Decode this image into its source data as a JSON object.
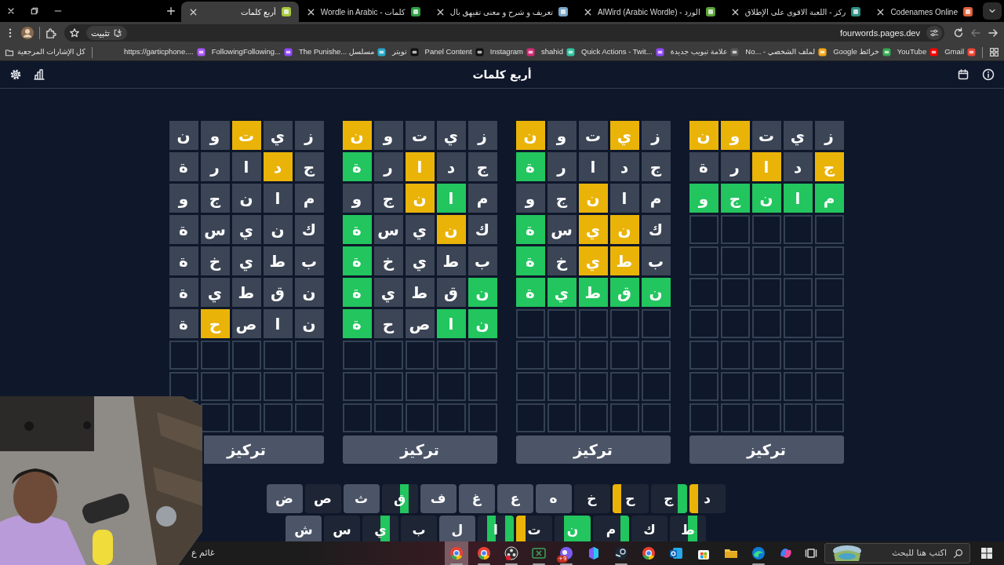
{
  "browser": {
    "tabs": [
      {
        "title": "Codenames Online",
        "selected": false
      },
      {
        "title": "ركز - اللعبة الاقوى على الإطلاق",
        "selected": false
      },
      {
        "title": "AlWird (Arabic Wordle) - الورد",
        "selected": false
      },
      {
        "title": "تعريف و شرح و معنى تفيهق بال",
        "selected": false
      },
      {
        "title": "Wordle in Arabic - كلمات",
        "selected": false
      },
      {
        "title": "أربع كلمات",
        "selected": true
      }
    ],
    "url": "fourwords.pages.dev",
    "install_button": "تثبيت",
    "bookmarks": [
      {
        "label": "Gmail"
      },
      {
        "label": "YouTube"
      },
      {
        "label": "خرائط Google"
      },
      {
        "label": "No... - لملف الشخصي"
      },
      {
        "label": "علامة تبويب جديدة"
      },
      {
        "label": "Quick Actions - Twit..."
      },
      {
        "label": "shahid"
      },
      {
        "label": "Instagram"
      },
      {
        "label": "Panel Content"
      },
      {
        "label": "تويتر"
      },
      {
        "label": "The Punishe... مسلسل"
      },
      {
        "label": "FollowingFollowing..."
      },
      {
        "label": "https://garticphone...."
      }
    ],
    "all_bookmarks": "كل الإشارات المرجعية"
  },
  "game": {
    "title": "أربع كلمات",
    "boards": [
      {
        "button": "تركيز",
        "rows": [
          {
            "tiles": [
              {
                "letter": "ز",
                "color": "#3b4556"
              },
              {
                "letter": "ي",
                "color": "#3b4556"
              },
              {
                "letter": "ت",
                "color": "#3b4556"
              },
              {
                "letter": "و",
                "color": "#eab308"
              },
              {
                "letter": "ن",
                "color": "#eab308"
              }
            ]
          },
          {
            "tiles": [
              {
                "letter": "ج",
                "color": "#eab308"
              },
              {
                "letter": "د",
                "color": "#3b4556"
              },
              {
                "letter": "ا",
                "color": "#eab308"
              },
              {
                "letter": "ر",
                "color": "#3b4556"
              },
              {
                "letter": "ة",
                "color": "#3b4556"
              }
            ]
          },
          {
            "tiles": [
              {
                "letter": "م",
                "color": "#22c55e"
              },
              {
                "letter": "ا",
                "color": "#22c55e"
              },
              {
                "letter": "ن",
                "color": "#22c55e"
              },
              {
                "letter": "ج",
                "color": "#22c55e"
              },
              {
                "letter": "و",
                "color": "#22c55e"
              }
            ]
          }
        ]
      },
      {
        "button": "تركيز",
        "rows": [
          {
            "tiles": [
              {
                "letter": "ز",
                "color": "#3b4556"
              },
              {
                "letter": "ي",
                "color": "#eab308"
              },
              {
                "letter": "ت",
                "color": "#3b4556"
              },
              {
                "letter": "و",
                "color": "#3b4556"
              },
              {
                "letter": "ن",
                "color": "#eab308"
              }
            ]
          },
          {
            "tiles": [
              {
                "letter": "ج",
                "color": "#3b4556"
              },
              {
                "letter": "د",
                "color": "#3b4556"
              },
              {
                "letter": "ا",
                "color": "#3b4556"
              },
              {
                "letter": "ر",
                "color": "#3b4556"
              },
              {
                "letter": "ة",
                "color": "#22c55e"
              }
            ]
          },
          {
            "tiles": [
              {
                "letter": "م",
                "color": "#3b4556"
              },
              {
                "letter": "ا",
                "color": "#3b4556"
              },
              {
                "letter": "ن",
                "color": "#eab308"
              },
              {
                "letter": "ج",
                "color": "#3b4556"
              },
              {
                "letter": "و",
                "color": "#3b4556"
              }
            ]
          },
          {
            "tiles": [
              {
                "letter": "ك",
                "color": "#3b4556"
              },
              {
                "letter": "ن",
                "color": "#eab308"
              },
              {
                "letter": "ي",
                "color": "#eab308"
              },
              {
                "letter": "س",
                "color": "#3b4556"
              },
              {
                "letter": "ة",
                "color": "#22c55e"
              }
            ]
          },
          {
            "tiles": [
              {
                "letter": "ب",
                "color": "#3b4556"
              },
              {
                "letter": "ط",
                "color": "#eab308"
              },
              {
                "letter": "ي",
                "color": "#eab308"
              },
              {
                "letter": "خ",
                "color": "#3b4556"
              },
              {
                "letter": "ة",
                "color": "#22c55e"
              }
            ]
          },
          {
            "tiles": [
              {
                "letter": "ن",
                "color": "#22c55e"
              },
              {
                "letter": "ق",
                "color": "#22c55e"
              },
              {
                "letter": "ط",
                "color": "#22c55e"
              },
              {
                "letter": "ي",
                "color": "#22c55e"
              },
              {
                "letter": "ة",
                "color": "#22c55e"
              }
            ]
          }
        ]
      },
      {
        "button": "تركيز",
        "rows": [
          {
            "tiles": [
              {
                "letter": "ز",
                "color": "#3b4556"
              },
              {
                "letter": "ي",
                "color": "#3b4556"
              },
              {
                "letter": "ت",
                "color": "#3b4556"
              },
              {
                "letter": "و",
                "color": "#3b4556"
              },
              {
                "letter": "ن",
                "color": "#eab308"
              }
            ]
          },
          {
            "tiles": [
              {
                "letter": "ج",
                "color": "#3b4556"
              },
              {
                "letter": "د",
                "color": "#3b4556"
              },
              {
                "letter": "ا",
                "color": "#eab308"
              },
              {
                "letter": "ر",
                "color": "#3b4556"
              },
              {
                "letter": "ة",
                "color": "#22c55e"
              }
            ]
          },
          {
            "tiles": [
              {
                "letter": "م",
                "color": "#3b4556"
              },
              {
                "letter": "ا",
                "color": "#22c55e"
              },
              {
                "letter": "ن",
                "color": "#eab308"
              },
              {
                "letter": "ج",
                "color": "#3b4556"
              },
              {
                "letter": "و",
                "color": "#3b4556"
              }
            ]
          },
          {
            "tiles": [
              {
                "letter": "ك",
                "color": "#3b4556"
              },
              {
                "letter": "ن",
                "color": "#eab308"
              },
              {
                "letter": "ي",
                "color": "#3b4556"
              },
              {
                "letter": "س",
                "color": "#3b4556"
              },
              {
                "letter": "ة",
                "color": "#22c55e"
              }
            ]
          },
          {
            "tiles": [
              {
                "letter": "ب",
                "color": "#3b4556"
              },
              {
                "letter": "ط",
                "color": "#3b4556"
              },
              {
                "letter": "ي",
                "color": "#3b4556"
              },
              {
                "letter": "خ",
                "color": "#3b4556"
              },
              {
                "letter": "ة",
                "color": "#22c55e"
              }
            ]
          },
          {
            "tiles": [
              {
                "letter": "ن",
                "color": "#22c55e"
              },
              {
                "letter": "ق",
                "color": "#3b4556"
              },
              {
                "letter": "ط",
                "color": "#3b4556"
              },
              {
                "letter": "ي",
                "color": "#3b4556"
              },
              {
                "letter": "ة",
                "color": "#22c55e"
              }
            ]
          },
          {
            "tiles": [
              {
                "letter": "ن",
                "color": "#22c55e"
              },
              {
                "letter": "ا",
                "color": "#22c55e"
              },
              {
                "letter": "ص",
                "color": "#3b4556"
              },
              {
                "letter": "ح",
                "color": "#3b4556"
              },
              {
                "letter": "ة",
                "color": "#22c55e"
              }
            ]
          }
        ]
      },
      {
        "button": "تركيز",
        "rows": [
          {
            "tiles": [
              {
                "letter": "ز",
                "color": "#3b4556"
              },
              {
                "letter": "ي",
                "color": "#3b4556"
              },
              {
                "letter": "ت",
                "color": "#eab308"
              },
              {
                "letter": "و",
                "color": "#3b4556"
              },
              {
                "letter": "ن",
                "color": "#3b4556"
              }
            ]
          },
          {
            "tiles": [
              {
                "letter": "ج",
                "color": "#3b4556"
              },
              {
                "letter": "د",
                "color": "#eab308"
              },
              {
                "letter": "ا",
                "color": "#3b4556"
              },
              {
                "letter": "ر",
                "color": "#3b4556"
              },
              {
                "letter": "ة",
                "color": "#3b4556"
              }
            ]
          },
          {
            "tiles": [
              {
                "letter": "م",
                "color": "#3b4556"
              },
              {
                "letter": "ا",
                "color": "#3b4556"
              },
              {
                "letter": "ن",
                "color": "#3b4556"
              },
              {
                "letter": "ج",
                "color": "#3b4556"
              },
              {
                "letter": "و",
                "color": "#3b4556"
              }
            ]
          },
          {
            "tiles": [
              {
                "letter": "ك",
                "color": "#3b4556"
              },
              {
                "letter": "ن",
                "color": "#3b4556"
              },
              {
                "letter": "ي",
                "color": "#3b4556"
              },
              {
                "letter": "س",
                "color": "#3b4556"
              },
              {
                "letter": "ة",
                "color": "#3b4556"
              }
            ]
          },
          {
            "tiles": [
              {
                "letter": "ب",
                "color": "#3b4556"
              },
              {
                "letter": "ط",
                "color": "#3b4556"
              },
              {
                "letter": "ي",
                "color": "#3b4556"
              },
              {
                "letter": "خ",
                "color": "#3b4556"
              },
              {
                "letter": "ة",
                "color": "#3b4556"
              }
            ]
          },
          {
            "tiles": [
              {
                "letter": "ن",
                "color": "#3b4556"
              },
              {
                "letter": "ق",
                "color": "#3b4556"
              },
              {
                "letter": "ط",
                "color": "#3b4556"
              },
              {
                "letter": "ي",
                "color": "#3b4556"
              },
              {
                "letter": "ة",
                "color": "#3b4556"
              }
            ]
          },
          {
            "tiles": [
              {
                "letter": "ن",
                "color": "#3b4556"
              },
              {
                "letter": "ا",
                "color": "#3b4556"
              },
              {
                "letter": "ص",
                "color": "#3b4556"
              },
              {
                "letter": "ح",
                "color": "#eab308"
              },
              {
                "letter": "ة",
                "color": "#3b4556"
              }
            ]
          }
        ]
      }
    ],
    "keyboard": [
      {
        "keys": [
          {
            "key": "د",
            "color": "#1e2636",
            "strips": [
              {
                "marked": false
              },
              {
                "marked": false
              },
              {
                "marked": false
              },
              {
                "marked": true,
                "color": "#eab308"
              }
            ]
          },
          {
            "key": "ج",
            "color": "#1e2636",
            "strips": [
              {
                "marked": true,
                "color": "#22c55e"
              },
              {
                "marked": false
              },
              {
                "marked": false
              },
              {
                "marked": false
              }
            ]
          },
          {
            "key": "ح",
            "color": "#1e2636",
            "strips": [
              {
                "marked": false
              },
              {
                "marked": false
              },
              {
                "marked": false
              },
              {
                "marked": true,
                "color": "#eab308"
              }
            ]
          },
          {
            "key": "خ",
            "color": "#1e2636",
            "strips": [
              {
                "marked": false
              },
              {
                "marked": false
              },
              {
                "marked": false
              },
              {
                "marked": false
              }
            ]
          },
          {
            "key": "ه",
            "color": "#4b5567",
            "strips": [
              {
                "marked": false
              },
              {
                "marked": false
              },
              {
                "marked": false
              },
              {
                "marked": false
              }
            ]
          },
          {
            "key": "ع",
            "color": "#4b5567",
            "strips": [
              {
                "marked": false
              },
              {
                "marked": false
              },
              {
                "marked": false
              },
              {
                "marked": false
              }
            ]
          },
          {
            "key": "غ",
            "color": "#4b5567",
            "strips": [
              {
                "marked": false
              },
              {
                "marked": false
              },
              {
                "marked": false
              },
              {
                "marked": false
              }
            ]
          },
          {
            "key": "ف",
            "color": "#4b5567",
            "strips": [
              {
                "marked": false
              },
              {
                "marked": false
              },
              {
                "marked": false
              },
              {
                "marked": false
              }
            ]
          },
          {
            "key": "ق",
            "color": "#1e2636",
            "strips": [
              {
                "marked": false
              },
              {
                "marked": true,
                "color": "#22c55e"
              },
              {
                "marked": false
              },
              {
                "marked": false
              }
            ]
          },
          {
            "key": "ث",
            "color": "#4b5567",
            "strips": [
              {
                "marked": false
              },
              {
                "marked": false
              },
              {
                "marked": false
              },
              {
                "marked": false
              }
            ]
          },
          {
            "key": "ص",
            "color": "#1e2636",
            "strips": [
              {
                "marked": false
              },
              {
                "marked": false
              },
              {
                "marked": false
              },
              {
                "marked": false
              }
            ]
          },
          {
            "key": "ض",
            "color": "#4b5567",
            "strips": [
              {
                "marked": false
              },
              {
                "marked": false
              },
              {
                "marked": false
              },
              {
                "marked": false
              }
            ]
          }
        ]
      },
      {
        "keys": [
          {
            "key": "ط",
            "color": "#1e2636",
            "strips": [
              {
                "marked": false
              },
              {
                "marked": true,
                "color": "#22c55e"
              },
              {
                "marked": false
              },
              {
                "marked": false
              }
            ]
          },
          {
            "key": "ك",
            "color": "#1e2636",
            "strips": [
              {
                "marked": false
              },
              {
                "marked": false
              },
              {
                "marked": false
              },
              {
                "marked": false
              }
            ]
          },
          {
            "key": "م",
            "color": "#1e2636",
            "strips": [
              {
                "marked": true,
                "color": "#22c55e"
              },
              {
                "marked": false
              },
              {
                "marked": false
              },
              {
                "marked": false
              }
            ]
          },
          {
            "key": "ن",
            "color": "#1e2636",
            "strips": [
              {
                "marked": true,
                "color": "#22c55e"
              },
              {
                "marked": true,
                "color": "#22c55e"
              },
              {
                "marked": true,
                "color": "#22c55e"
              },
              {
                "marked": false
              }
            ]
          },
          {
            "key": "ت",
            "color": "#1e2636",
            "strips": [
              {
                "marked": false
              },
              {
                "marked": false
              },
              {
                "marked": false
              },
              {
                "marked": true,
                "color": "#eab308"
              }
            ]
          },
          {
            "key": "ا",
            "color": "#1e2636",
            "strips": [
              {
                "marked": true,
                "color": "#22c55e"
              },
              {
                "marked": false
              },
              {
                "marked": true,
                "color": "#22c55e"
              },
              {
                "marked": false
              }
            ]
          },
          {
            "key": "ل",
            "color": "#4b5567",
            "strips": [
              {
                "marked": false
              },
              {
                "marked": false
              },
              {
                "marked": false
              },
              {
                "marked": false
              }
            ]
          },
          {
            "key": "ب",
            "color": "#1e2636",
            "strips": [
              {
                "marked": false
              },
              {
                "marked": false
              },
              {
                "marked": false
              },
              {
                "marked": false
              }
            ]
          },
          {
            "key": "ي",
            "color": "#1e2636",
            "strips": [
              {
                "marked": false
              },
              {
                "marked": true,
                "color": "#22c55e"
              },
              {
                "marked": false
              },
              {
                "marked": false
              }
            ]
          },
          {
            "key": "س",
            "color": "#1e2636",
            "strips": [
              {
                "marked": false
              },
              {
                "marked": false
              },
              {
                "marked": false
              },
              {
                "marked": false
              }
            ]
          },
          {
            "key": "ش",
            "color": "#4b5567",
            "strips": [
              {
                "marked": false
              },
              {
                "marked": false
              },
              {
                "marked": false
              },
              {
                "marked": false
              }
            ]
          }
        ]
      }
    ]
  },
  "taskbar": {
    "search_placeholder": "اكتب هنا للبحث",
    "weather": "غائم ع",
    "apps": [
      {
        "kind": "swirl",
        "running": false,
        "selected": false
      },
      {
        "kind": "wave",
        "running": true,
        "selected": false
      },
      {
        "kind": "folder",
        "running": false,
        "selected": false
      },
      {
        "kind": "bag",
        "running": false,
        "selected": false
      },
      {
        "kind": "mail",
        "running": false,
        "selected": false
      },
      {
        "kind": "browser",
        "running": false,
        "selected": false
      },
      {
        "kind": "steam",
        "running": true,
        "selected": false
      },
      {
        "kind": "office",
        "running": false,
        "selected": false
      },
      {
        "kind": "chat",
        "running": true,
        "selected": false,
        "badge": "9+"
      },
      {
        "kind": "sheet",
        "running": true,
        "selected": false
      },
      {
        "kind": "recorder",
        "running": true,
        "selected": false
      },
      {
        "kind": "browser",
        "running": true,
        "selected": false
      },
      {
        "kind": "browser",
        "running": true,
        "selected": true
      }
    ]
  }
}
